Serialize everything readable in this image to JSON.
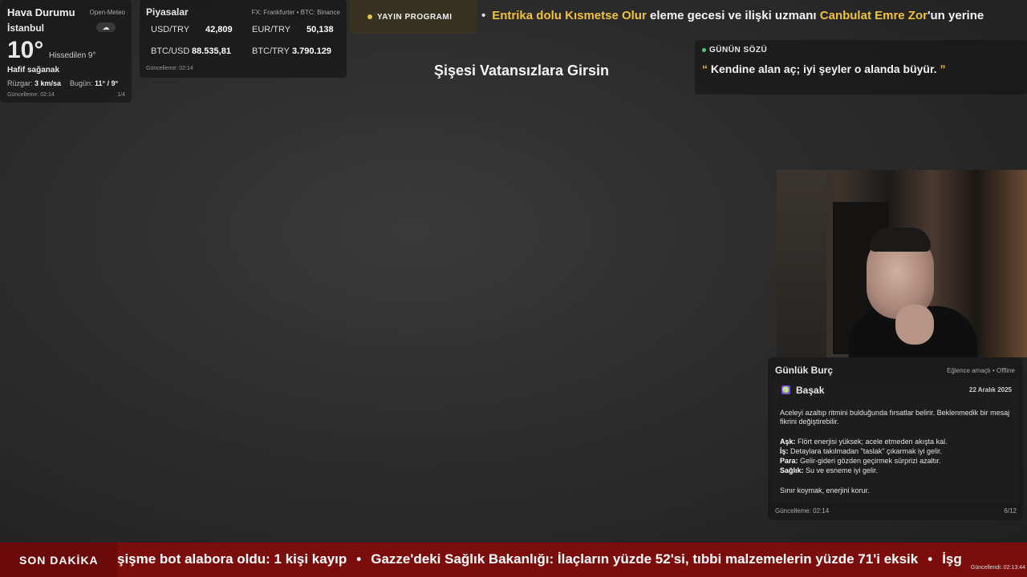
{
  "weather": {
    "title": "Hava Durumu",
    "source": "Open-Meteo",
    "city": "İstanbul",
    "temperature": "10°",
    "feels_like": "Hissedilen 9°",
    "condition": "Hafif sağanak",
    "wind_label": "Rüzgar:",
    "wind_value": "3 km/sa",
    "today_label": "Bugün:",
    "today_value": "11° / 9°",
    "updated": "Güncelleme: 02:14",
    "page": "1/4",
    "icon": "cloud-rain-icon"
  },
  "markets": {
    "title": "Piyasalar",
    "source": "FX: Frankfurter • BTC: Binance",
    "rates": [
      {
        "label": "USD/TRY",
        "value": "42,809"
      },
      {
        "label": "EUR/TRY",
        "value": "50,138"
      },
      {
        "label": "BTC/USD",
        "value": "88.535,81"
      },
      {
        "label": "BTC/TRY",
        "value": "3.790.129"
      }
    ],
    "updated": "Güncelleme: 02:14"
  },
  "program": {
    "label": "YAYIN PROGRAMI",
    "ticker_part1": "Entrika dolu Kısmetse Olur",
    "ticker_part2": " eleme gecesi ve ilişki uzmanı ",
    "ticker_part3": "Canbulat Emre Zor",
    "ticker_part4": "'un yerine",
    "accent": "#f0c23a"
  },
  "center_title": "Şişesi Vatansızlara Girsin",
  "quote": {
    "label": "GÜNÜN SÖZÜ",
    "text": "Kendine alan aç; iyi şeyler o alanda büyür."
  },
  "horoscope": {
    "title": "Günlük Burç",
    "mode": "Eğlence amaçlı • Offline",
    "sign": "Başak",
    "sign_icon": "♍",
    "date": "22 Aralık 2025",
    "intro": "Aceleyi azaltıp ritmini bulduğunda fırsatlar belirir. Beklenmedik bir mesaj fikrini değiştirebilir.",
    "love_label": "Aşk:",
    "love": " Flört enerjisi yüksek; acele etmeden akışta kal.",
    "work_label": "İş:",
    "work": " Detaylara takılmadan \"taslak\" çıkarmak iyi gelir.",
    "money_label": "Para:",
    "money": " Gelir-gideri gözden geçirmek sürprizi azaltır.",
    "health_label": "Sağlık:",
    "health": " Su ve esneme iyi gelir.",
    "advice": "Sınır koymak, enerjini korur.",
    "updated": "Güncelleme: 02:14",
    "page": "6/12"
  },
  "breaking": {
    "label": "SON DAKİKA",
    "item1": "şişme bot alabora oldu: 1 kişi kayıp",
    "item2": "Gazze'deki Sağlık Bakanlığı: İlaçların yüzde 52'si, tıbbi malzemelerin yüzde 71'i eksik",
    "item3": "İşg",
    "separator": "•",
    "updated": "Güncellendi: 02:13:44",
    "color": "#7c0d0d"
  }
}
